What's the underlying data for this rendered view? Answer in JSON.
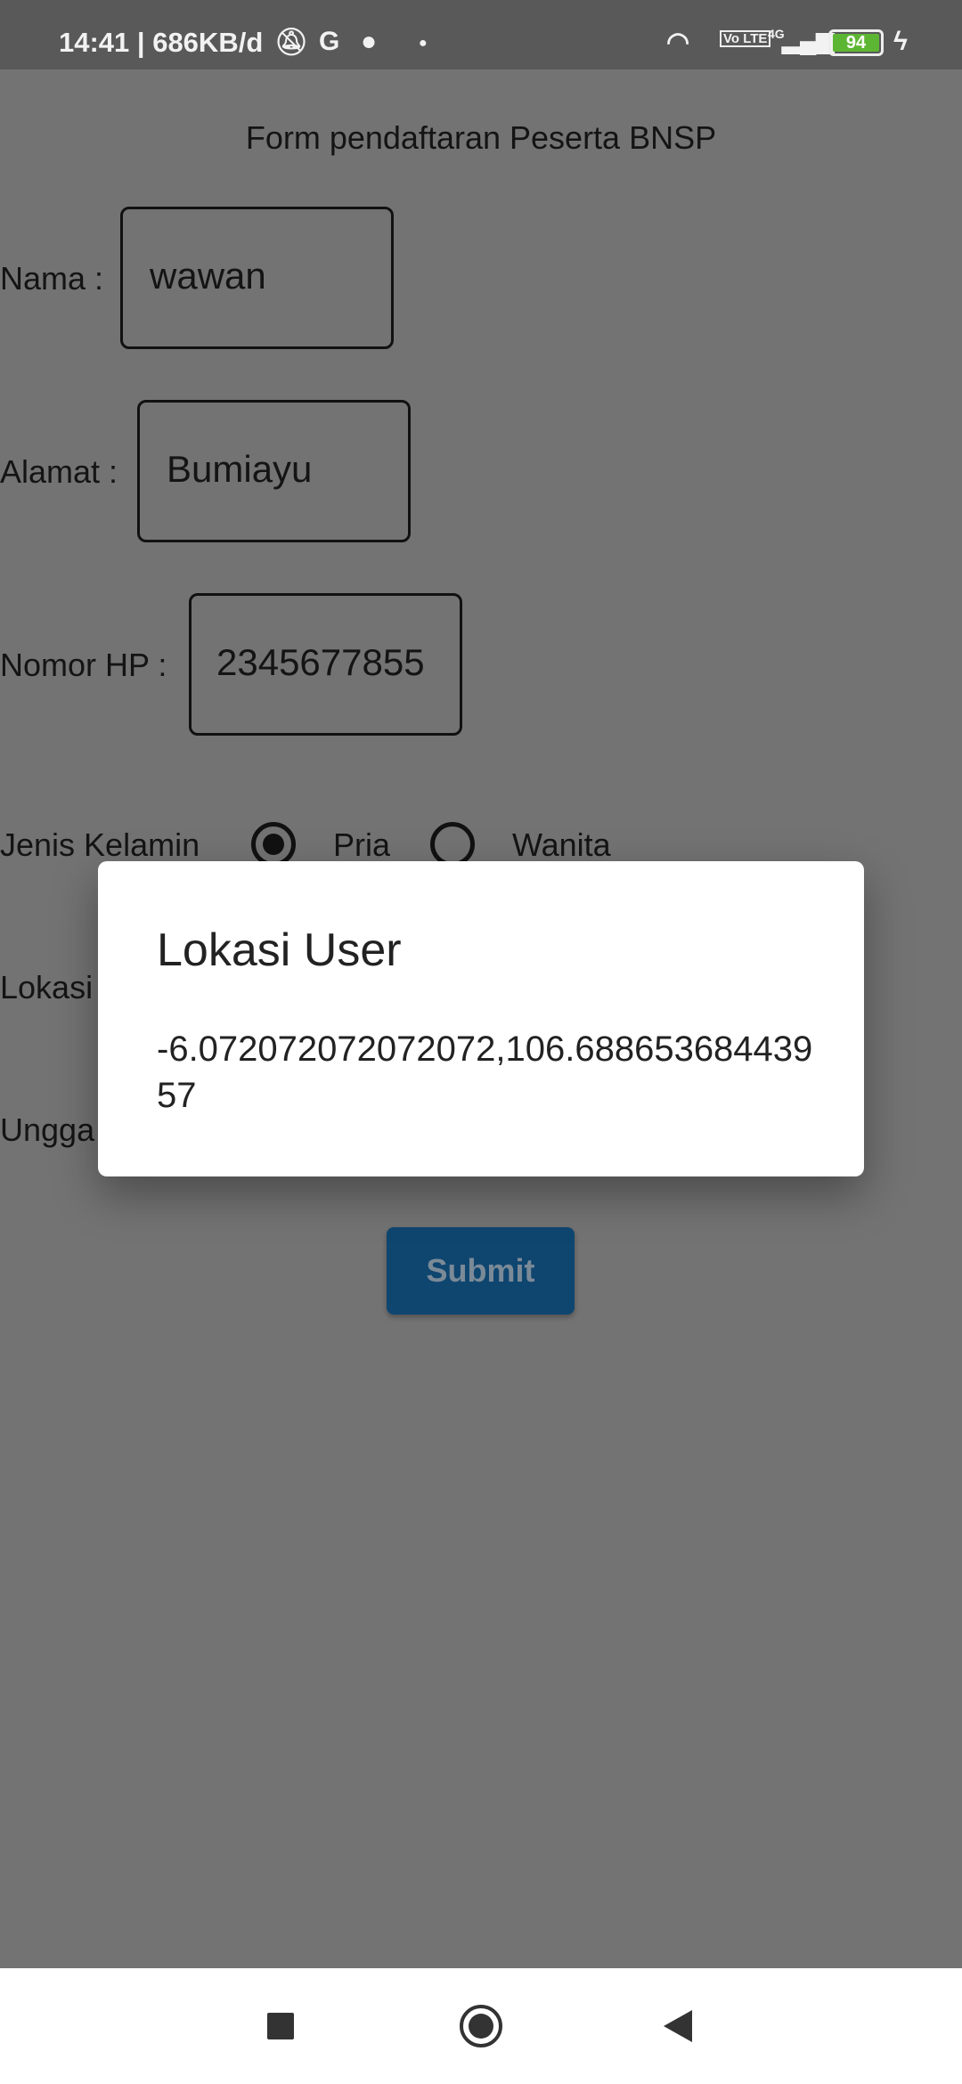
{
  "status_bar": {
    "time": "14:41",
    "data_usage": "686KB/d",
    "battery": "94",
    "network": "4G",
    "volte": "Vo LTE"
  },
  "form": {
    "title": "Form pendaftaran Peserta BNSP",
    "nama_label": "Nama :",
    "nama_value": "wawan",
    "alamat_label": "Alamat :",
    "alamat_value": "Bumiayu",
    "hp_label": "Nomor HP :",
    "hp_value": "2345677855",
    "gender_label": "Jenis Kelamin",
    "gender_options": [
      "Pria",
      "Wanita"
    ],
    "gender_selected": "Pria",
    "lokasi_label": "Lokasi",
    "unggah_label": "Ungga",
    "submit_label": "Submit"
  },
  "dialog": {
    "title": "Lokasi User",
    "message": "-6.072072072072072,106.68865368443957"
  }
}
